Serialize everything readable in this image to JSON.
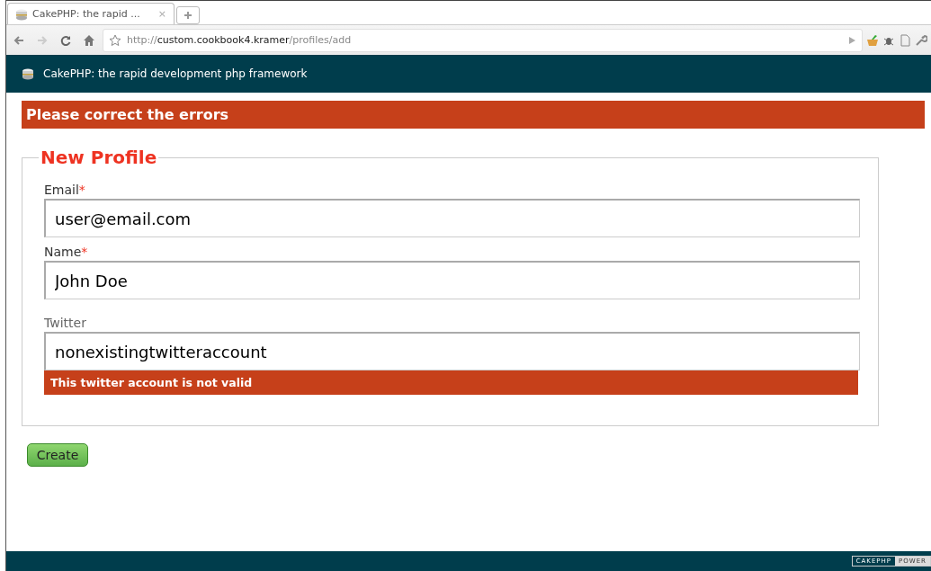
{
  "browser": {
    "tab": {
      "title": "CakePHP: the rapid ...",
      "close": "×"
    },
    "url": {
      "scheme": "http://",
      "host": "custom.cookbook4.kramer",
      "path": "/profiles/add"
    }
  },
  "header": {
    "title": "CakePHP: the rapid development php framework"
  },
  "flash": {
    "message": "Please correct the errors"
  },
  "form": {
    "legend": "New Profile",
    "fields": [
      {
        "label": "Email",
        "required_mark": "*",
        "value": "user@email.com"
      },
      {
        "label": "Name",
        "required_mark": "*",
        "value": "John Doe"
      },
      {
        "label": "Twitter",
        "value": "nonexistingtwitteraccount",
        "error": "This twitter account is not valid"
      }
    ],
    "submit": "Create"
  },
  "footer": {
    "badge": [
      "CAKEPHP",
      "POWER"
    ]
  }
}
